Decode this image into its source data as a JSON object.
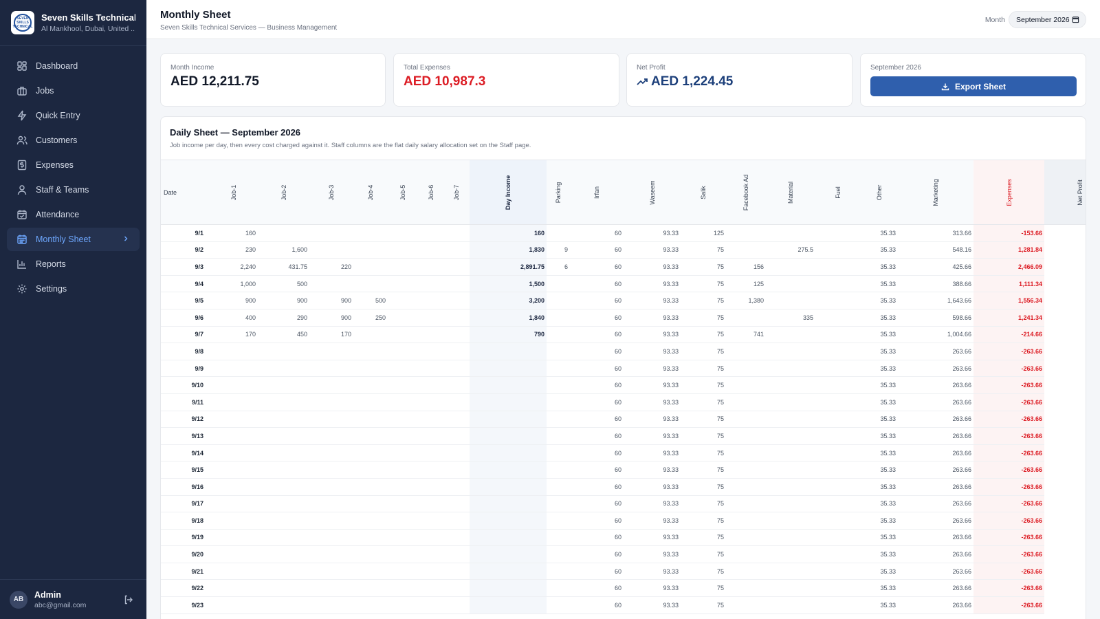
{
  "brand": {
    "name": "Seven Skills Technical ...",
    "location": "Al Mankhool, Dubai, United ...",
    "logo_text": "SEVEN SKILLS TECHNICAL"
  },
  "nav": [
    {
      "label": "Dashboard",
      "icon": "dashboard-icon"
    },
    {
      "label": "Jobs",
      "icon": "briefcase-icon"
    },
    {
      "label": "Quick Entry",
      "icon": "lightning-icon"
    },
    {
      "label": "Customers",
      "icon": "users-icon"
    },
    {
      "label": "Expenses",
      "icon": "receipt-icon"
    },
    {
      "label": "Staff & Teams",
      "icon": "team-icon"
    },
    {
      "label": "Attendance",
      "icon": "calendar-check-icon"
    },
    {
      "label": "Monthly Sheet",
      "icon": "calendar-icon",
      "active": true
    },
    {
      "label": "Reports",
      "icon": "bar-chart-icon"
    },
    {
      "label": "Settings",
      "icon": "gear-icon"
    }
  ],
  "user": {
    "initials": "AB",
    "name": "Admin",
    "email": "abc@gmail.com"
  },
  "header": {
    "title": "Monthly Sheet",
    "subtitle": "Seven Skills Technical Services — Business Management",
    "month_label": "Month",
    "month_value": "September 2026"
  },
  "cards": {
    "income": {
      "label": "Month Income",
      "value": "AED 12,211.75"
    },
    "expenses": {
      "label": "Total Expenses",
      "value": "AED 10,987.3"
    },
    "profit": {
      "label": "Net Profit",
      "value": "AED 1,224.45"
    },
    "export": {
      "label": "September 2026",
      "button": "Export Sheet"
    }
  },
  "sheet": {
    "title": "Daily Sheet — September 2026",
    "subtitle": "Job income per day, then every cost charged against it. Staff columns are the flat daily salary allocation set on the Staff page.",
    "columns": [
      "Date",
      "Job-1",
      "Job-2",
      "Job-3",
      "Job-4",
      "Job-5",
      "Job-6",
      "Job-7",
      "Day Income",
      "Parking",
      "Irfan",
      "Waseem",
      "Salik",
      "Facebook Ad",
      "Material",
      "Fuel",
      "Other",
      "Marketing",
      "Expenses",
      "Net Profit"
    ],
    "rows": [
      [
        "9/1",
        "160",
        "",
        "",
        "",
        "",
        "",
        "",
        "160",
        "",
        "60",
        "93.33",
        "125",
        "",
        "",
        "",
        "35.33",
        "313.66",
        "-153.66"
      ],
      [
        "9/2",
        "230",
        "1,600",
        "",
        "",
        "",
        "",
        "",
        "1,830",
        "9",
        "60",
        "93.33",
        "75",
        "",
        "275.5",
        "",
        "35.33",
        "548.16",
        "1,281.84"
      ],
      [
        "9/3",
        "2,240",
        "431.75",
        "220",
        "",
        "",
        "",
        "",
        "2,891.75",
        "6",
        "60",
        "93.33",
        "75",
        "156",
        "",
        "",
        "35.33",
        "425.66",
        "2,466.09"
      ],
      [
        "9/4",
        "1,000",
        "500",
        "",
        "",
        "",
        "",
        "",
        "1,500",
        "",
        "60",
        "93.33",
        "75",
        "125",
        "",
        "",
        "35.33",
        "388.66",
        "1,111.34"
      ],
      [
        "9/5",
        "900",
        "900",
        "900",
        "500",
        "",
        "",
        "",
        "3,200",
        "",
        "60",
        "93.33",
        "75",
        "1,380",
        "",
        "",
        "35.33",
        "1,643.66",
        "1,556.34"
      ],
      [
        "9/6",
        "400",
        "290",
        "900",
        "250",
        "",
        "",
        "",
        "1,840",
        "",
        "60",
        "93.33",
        "75",
        "",
        "335",
        "",
        "35.33",
        "598.66",
        "1,241.34"
      ],
      [
        "9/7",
        "170",
        "450",
        "170",
        "",
        "",
        "",
        "",
        "790",
        "",
        "60",
        "93.33",
        "75",
        "741",
        "",
        "",
        "35.33",
        "1,004.66",
        "-214.66"
      ],
      [
        "9/8",
        "",
        "",
        "",
        "",
        "",
        "",
        "",
        "",
        "",
        "60",
        "93.33",
        "75",
        "",
        "",
        "",
        "35.33",
        "263.66",
        "-263.66"
      ],
      [
        "9/9",
        "",
        "",
        "",
        "",
        "",
        "",
        "",
        "",
        "",
        "60",
        "93.33",
        "75",
        "",
        "",
        "",
        "35.33",
        "263.66",
        "-263.66"
      ],
      [
        "9/10",
        "",
        "",
        "",
        "",
        "",
        "",
        "",
        "",
        "",
        "60",
        "93.33",
        "75",
        "",
        "",
        "",
        "35.33",
        "263.66",
        "-263.66"
      ],
      [
        "9/11",
        "",
        "",
        "",
        "",
        "",
        "",
        "",
        "",
        "",
        "60",
        "93.33",
        "75",
        "",
        "",
        "",
        "35.33",
        "263.66",
        "-263.66"
      ],
      [
        "9/12",
        "",
        "",
        "",
        "",
        "",
        "",
        "",
        "",
        "",
        "60",
        "93.33",
        "75",
        "",
        "",
        "",
        "35.33",
        "263.66",
        "-263.66"
      ],
      [
        "9/13",
        "",
        "",
        "",
        "",
        "",
        "",
        "",
        "",
        "",
        "60",
        "93.33",
        "75",
        "",
        "",
        "",
        "35.33",
        "263.66",
        "-263.66"
      ],
      [
        "9/14",
        "",
        "",
        "",
        "",
        "",
        "",
        "",
        "",
        "",
        "60",
        "93.33",
        "75",
        "",
        "",
        "",
        "35.33",
        "263.66",
        "-263.66"
      ],
      [
        "9/15",
        "",
        "",
        "",
        "",
        "",
        "",
        "",
        "",
        "",
        "60",
        "93.33",
        "75",
        "",
        "",
        "",
        "35.33",
        "263.66",
        "-263.66"
      ],
      [
        "9/16",
        "",
        "",
        "",
        "",
        "",
        "",
        "",
        "",
        "",
        "60",
        "93.33",
        "75",
        "",
        "",
        "",
        "35.33",
        "263.66",
        "-263.66"
      ],
      [
        "9/17",
        "",
        "",
        "",
        "",
        "",
        "",
        "",
        "",
        "",
        "60",
        "93.33",
        "75",
        "",
        "",
        "",
        "35.33",
        "263.66",
        "-263.66"
      ],
      [
        "9/18",
        "",
        "",
        "",
        "",
        "",
        "",
        "",
        "",
        "",
        "60",
        "93.33",
        "75",
        "",
        "",
        "",
        "35.33",
        "263.66",
        "-263.66"
      ],
      [
        "9/19",
        "",
        "",
        "",
        "",
        "",
        "",
        "",
        "",
        "",
        "60",
        "93.33",
        "75",
        "",
        "",
        "",
        "35.33",
        "263.66",
        "-263.66"
      ],
      [
        "9/20",
        "",
        "",
        "",
        "",
        "",
        "",
        "",
        "",
        "",
        "60",
        "93.33",
        "75",
        "",
        "",
        "",
        "35.33",
        "263.66",
        "-263.66"
      ],
      [
        "9/21",
        "",
        "",
        "",
        "",
        "",
        "",
        "",
        "",
        "",
        "60",
        "93.33",
        "75",
        "",
        "",
        "",
        "35.33",
        "263.66",
        "-263.66"
      ],
      [
        "9/22",
        "",
        "",
        "",
        "",
        "",
        "",
        "",
        "",
        "",
        "60",
        "93.33",
        "75",
        "",
        "",
        "",
        "35.33",
        "263.66",
        "-263.66"
      ],
      [
        "9/23",
        "",
        "",
        "",
        "",
        "",
        "",
        "",
        "",
        "",
        "60",
        "93.33",
        "75",
        "",
        "",
        "",
        "35.33",
        "263.66",
        "-263.66"
      ]
    ]
  },
  "colors": {
    "sidebar_bg": "#1c2740",
    "active_nav": "#6ea8ff",
    "primary": "#2f5fad",
    "negative": "#dc1c24",
    "profit": "#1c3f7a"
  }
}
